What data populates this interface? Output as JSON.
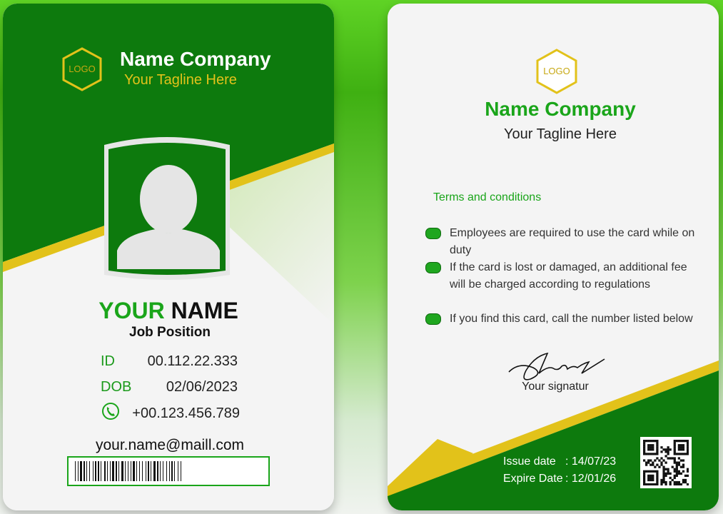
{
  "colors": {
    "green": "#0d7a0d",
    "bright_green": "#1aa51a",
    "gold": "#e2c21a",
    "white": "#f4f4f4"
  },
  "front": {
    "logo_text": "LOGO",
    "company_name": "Name Company",
    "tagline": "Your Tagline Here",
    "photo_icon": "person-silhouette-icon",
    "name_first": "YOUR",
    "name_last": "NAME",
    "position": "Job Position",
    "fields": [
      {
        "label": "ID",
        "value": "00.112.22.333"
      },
      {
        "label": "DOB",
        "value": "02/06/2023"
      }
    ],
    "phone_icon": "phone-icon",
    "phone": "+00.123.456.789",
    "email": "your.name@maill.com",
    "barcode_icon": "barcode-icon"
  },
  "back": {
    "logo_text": "LOGO",
    "company_name": "Name Company",
    "tagline": "Your Tagline Here",
    "terms_title": "Terms and conditions",
    "terms": [
      "Employees are required to use the card while on duty",
      "If the card is lost or damaged, an additional fee",
      "will be charged according to regulations",
      "If you find this card, call the number listed below"
    ],
    "signature_label": "Your signatur",
    "issue_label": "Issue date",
    "issue_value": ": 14/07/23",
    "expire_label": "Expire Date",
    "expire_value": ": 12/01/26",
    "qr_icon": "qr-code-icon"
  }
}
